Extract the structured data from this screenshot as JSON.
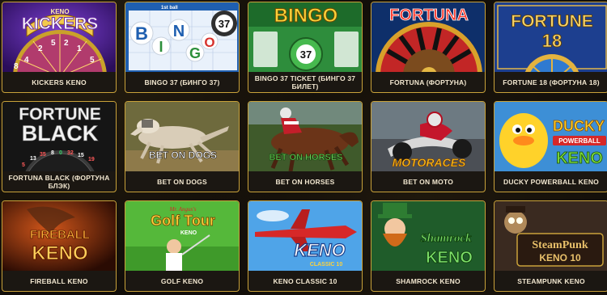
{
  "games": [
    {
      "label": "KICKERS KENO",
      "art_lines": [
        "KENO",
        "KICKERS"
      ],
      "wheel_numbers": [
        "4",
        "2",
        "5",
        "2",
        "1",
        "5",
        "8"
      ]
    },
    {
      "label": "BINGO 37 (БИНГО 37)",
      "art_lines": [
        "1st ball",
        "B",
        "I",
        "N",
        "G",
        "O",
        "37"
      ]
    },
    {
      "label": "BINGO 37 TICKET (БИНГО 37 БИЛЕТ)",
      "art_lines": [
        "BINGO",
        "37"
      ]
    },
    {
      "label": "FORTUNA (ФОРТУНА)",
      "art_lines": [
        "FORTUNA"
      ]
    },
    {
      "label": "FORTUNE 18 (ФОРТУНА 18)",
      "art_lines": [
        "FORTUNE",
        "18"
      ]
    },
    {
      "label": "FORTUNA BLACK (ФОРТУНА БЛЭК)",
      "art_lines": [
        "FORTUNE",
        "BLACK",
        "5",
        "13",
        "35",
        "8",
        "0",
        "32",
        "15",
        "19"
      ]
    },
    {
      "label": "BET ON DOGS",
      "art_lines": [
        "BET ON DOGS"
      ]
    },
    {
      "label": "BET ON HORSES",
      "art_lines": [
        "BET ON HORSES"
      ]
    },
    {
      "label": "BET ON MOTO",
      "art_lines": [
        "MOTORACES"
      ]
    },
    {
      "label": "DUCKY POWERBALL KENO",
      "art_lines": [
        "DUCKY",
        "POWERBALL",
        "KENO"
      ]
    },
    {
      "label": "FIREBALL KENO",
      "art_lines": [
        "FIREBALL",
        "KENO"
      ]
    },
    {
      "label": "GOLF KENO",
      "art_lines": [
        "Mr. Angus's",
        "Golf Tour",
        "KENO"
      ]
    },
    {
      "label": "KENO CLASSIC 10",
      "art_lines": [
        "KENO",
        "CLASSIC 10"
      ]
    },
    {
      "label": "SHAMROCK KENO",
      "art_lines": [
        "Shamrock",
        "KENO"
      ]
    },
    {
      "label": "STEAMPUNK KENO",
      "art_lines": [
        "SteamPunk",
        "KENO 10"
      ]
    }
  ],
  "colors": {
    "card_border": "#c9a23a",
    "label_text": "#f1e6cf",
    "background": "#120e09"
  }
}
